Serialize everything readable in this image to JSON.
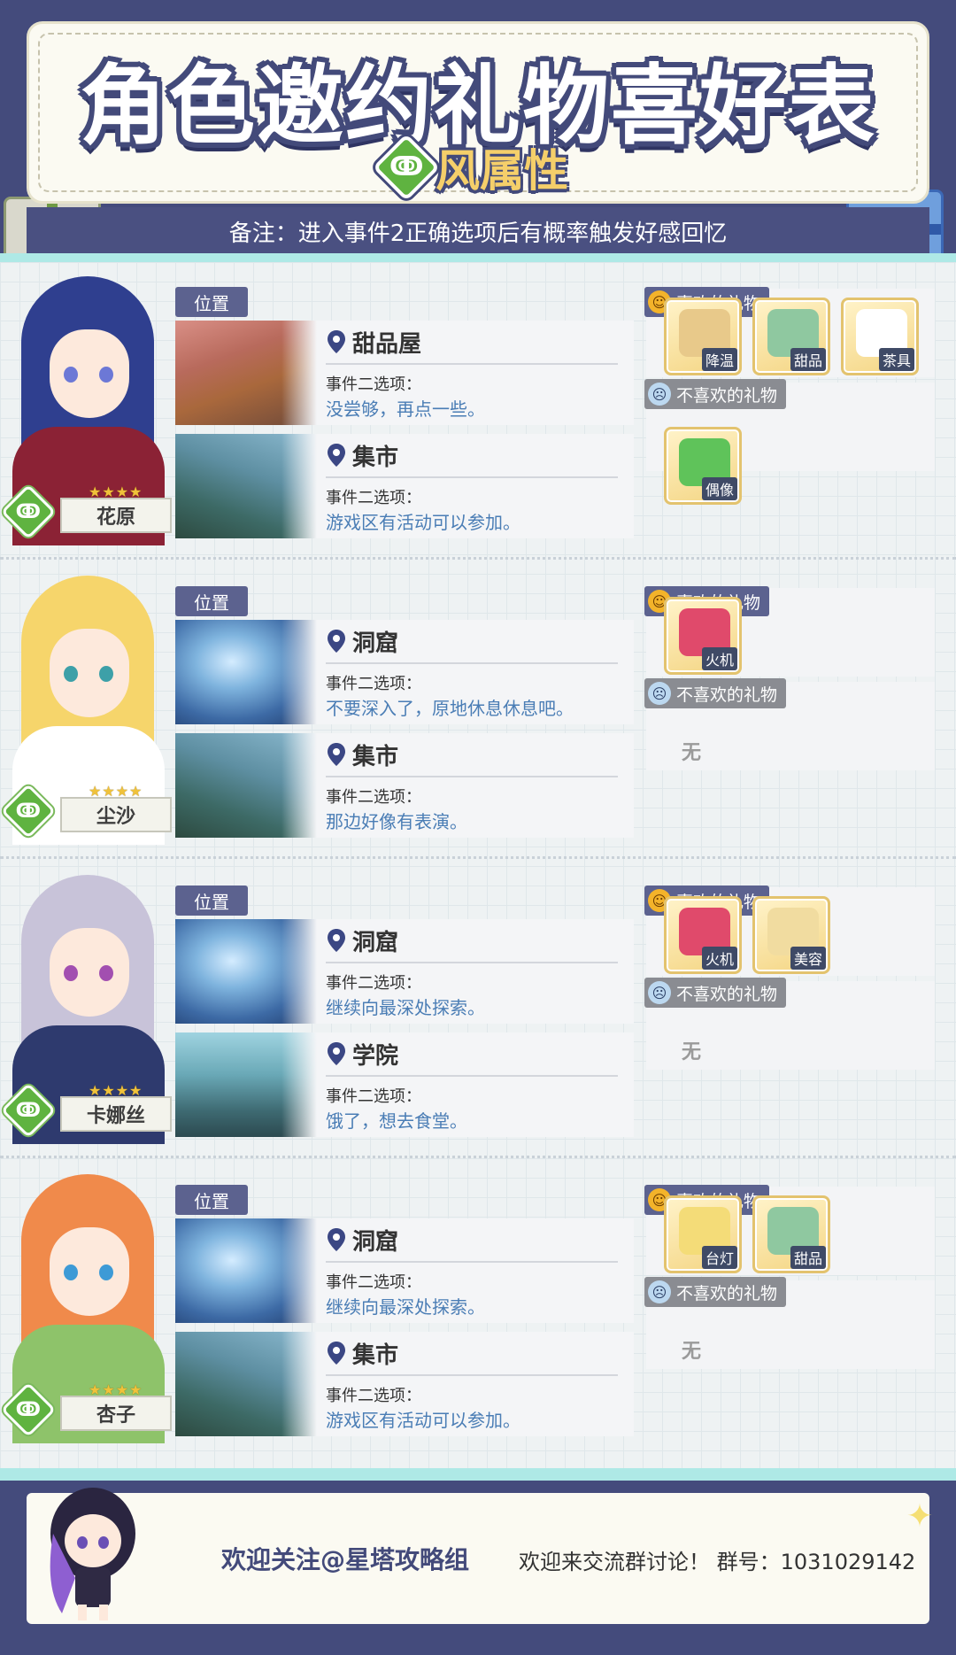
{
  "header": {
    "title": "角色邀约礼物喜好表",
    "subtitle": "风属性",
    "note": "备注：进入事件2正确选项后有概率触发好感回忆"
  },
  "labels": {
    "position": "位置",
    "event_option": "事件二选项：",
    "liked_gifts": "喜欢的礼物",
    "disliked_gifts": "不喜欢的礼物",
    "none": "无"
  },
  "characters": [
    {
      "name": "花原",
      "stars": 4,
      "locations": [
        {
          "name": "甜品屋",
          "option": "没尝够，再点一些。",
          "thumb": "dessert"
        },
        {
          "name": "集市",
          "option": "游戏区有活动可以参加。",
          "thumb": "market"
        }
      ],
      "liked": [
        "降温",
        "甜品",
        "茶具"
      ],
      "disliked": [
        "偶像"
      ]
    },
    {
      "name": "尘沙",
      "stars": 4,
      "locations": [
        {
          "name": "洞窟",
          "option": "不要深入了，原地休息休息吧。",
          "thumb": "cave"
        },
        {
          "name": "集市",
          "option": "那边好像有表演。",
          "thumb": "market"
        }
      ],
      "liked": [
        "火机"
      ],
      "disliked": []
    },
    {
      "name": "卡娜丝",
      "stars": 4,
      "locations": [
        {
          "name": "洞窟",
          "option": "继续向最深处探索。",
          "thumb": "cave"
        },
        {
          "name": "学院",
          "option": "饿了，想去食堂。",
          "thumb": "school"
        }
      ],
      "liked": [
        "火机",
        "美容"
      ],
      "disliked": []
    },
    {
      "name": "杏子",
      "stars": 4,
      "locations": [
        {
          "name": "洞窟",
          "option": "继续向最深处探索。",
          "thumb": "cave"
        },
        {
          "name": "集市",
          "option": "游戏区有活动可以参加。",
          "thumb": "market"
        }
      ],
      "liked": [
        "台灯",
        "甜品"
      ],
      "disliked": []
    }
  ],
  "footer": {
    "follow": "欢迎关注@星塔攻略组",
    "group": "欢迎来交流群讨论！ 群号：1031029142"
  },
  "colors": {
    "navy": "#444b7c",
    "wind_green": "#5fb340",
    "title_yellow": "#f5cf6a",
    "option_blue": "#4a7db5",
    "cyan": "#aee9e6"
  },
  "icons": {
    "element": "wind-element-icon",
    "location": "location-pin-icon",
    "like": "happy-face-icon",
    "dislike": "sad-face-icon"
  }
}
